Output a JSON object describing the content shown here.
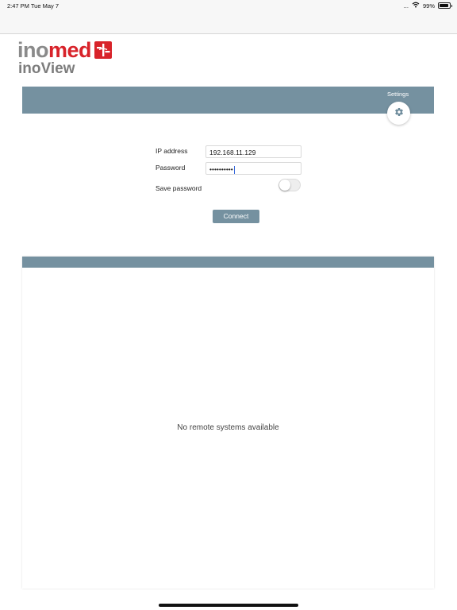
{
  "status_bar": {
    "time_date": "2:47 PM   Tue May 7",
    "signal_text": "...",
    "battery_percent": "99%",
    "icons": [
      "wifi-icon",
      "battery-icon"
    ]
  },
  "logo": {
    "brand_part1": "ino",
    "brand_part2": "med",
    "product": "inoView"
  },
  "settings": {
    "label": "Settings",
    "icon": "gear-icon"
  },
  "form": {
    "ip_label": "IP address",
    "ip_value": "192.168.11.129",
    "password_label": "Password",
    "password_value": "••••••••••",
    "save_password_label": "Save password",
    "save_password_on": false,
    "connect_label": "Connect"
  },
  "remote_systems": {
    "empty_message": "No remote systems available"
  },
  "colors": {
    "accent": "#7591a0",
    "brand_red": "#d8232a",
    "brand_gray": "#8a8a8a"
  }
}
